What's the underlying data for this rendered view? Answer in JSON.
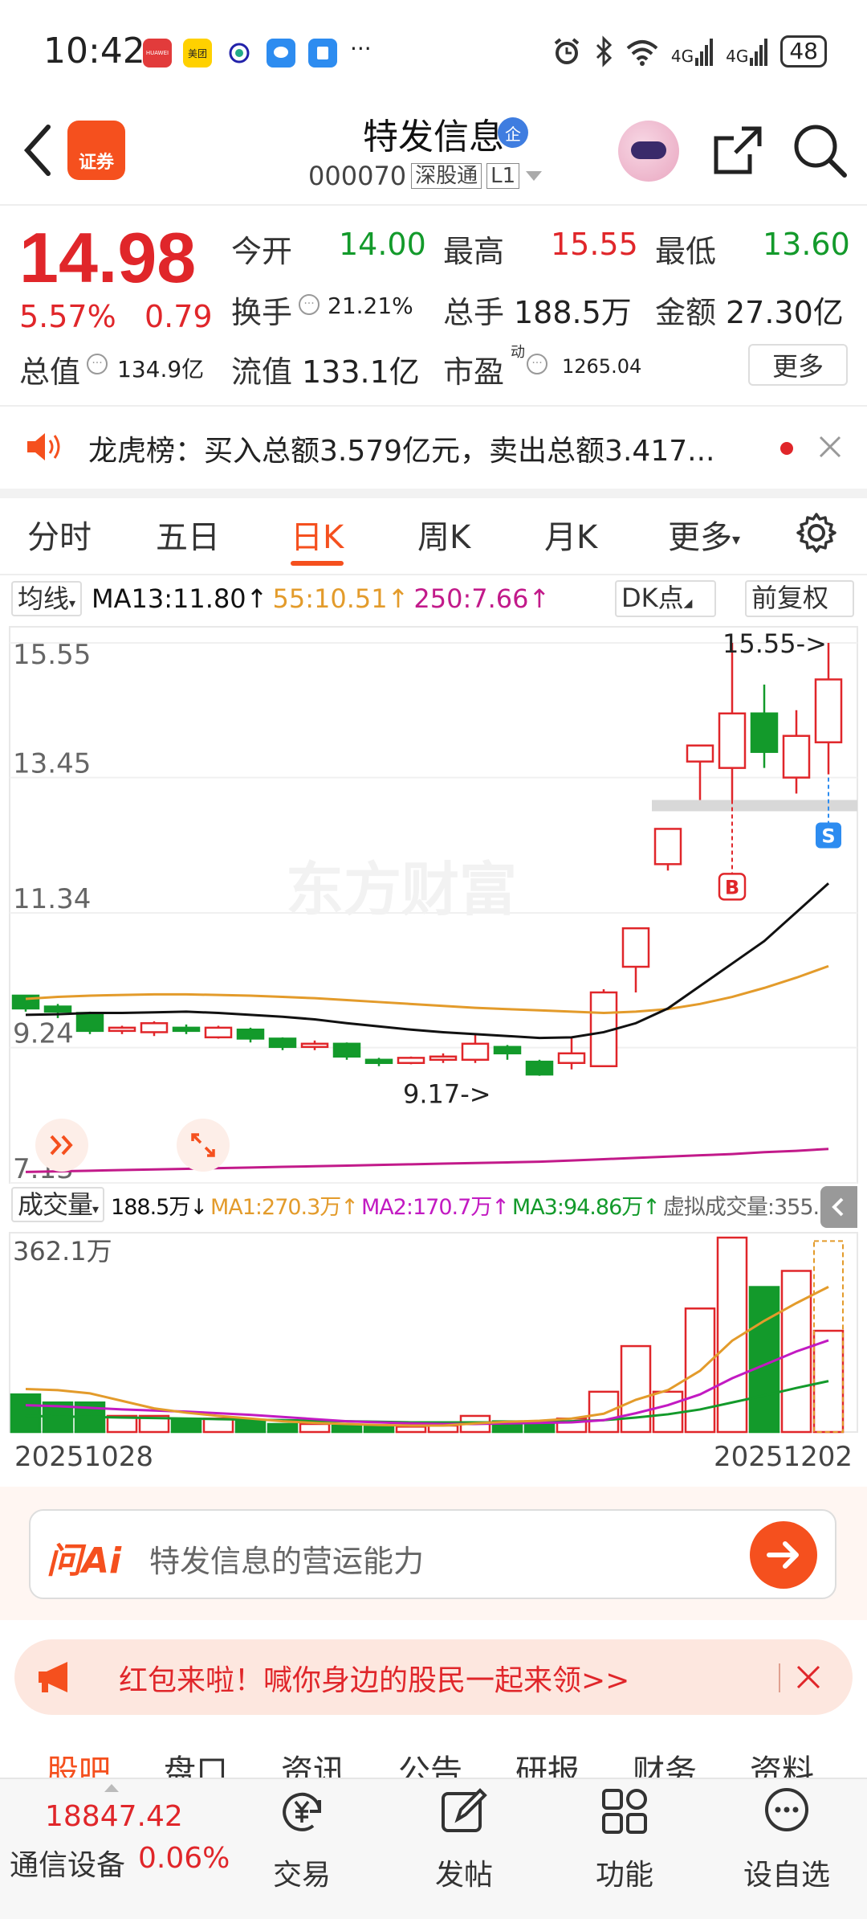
{
  "status_bar": {
    "time": "10:42",
    "battery": "48",
    "more": "···",
    "signal_label": "4G",
    "apps": [
      "HUAWEI",
      "美团",
      "",
      "",
      ""
    ]
  },
  "header": {
    "stock_name": "特发信息",
    "badge": "企",
    "stock_code": "000070",
    "tag_connect": "深股通",
    "tag_level": "L1",
    "app_logo_text": "证券"
  },
  "quote": {
    "price": "14.98",
    "change_pct": "5.57%",
    "change_amt": "0.79",
    "open_label": "今开",
    "open": "14.00",
    "high_label": "最高",
    "high": "15.55",
    "low_label": "最低",
    "low": "13.60",
    "turnover_label": "换手",
    "turnover": "21.21%",
    "volume_label": "总手",
    "volume": "188.5万",
    "amount_label": "金额",
    "amount": "27.30亿",
    "mcap_label": "总值",
    "mcap": "134.9亿",
    "float_label": "流值",
    "float_cap": "133.1亿",
    "pe_label": "市盈",
    "pe_sup": "动",
    "pe": "1265.04",
    "more_button": "更多"
  },
  "banner": {
    "text": "龙虎榜：买入总额3.579亿元，卖出总额3.417..."
  },
  "tabs": [
    {
      "label": "分时",
      "active": false
    },
    {
      "label": "五日",
      "active": false
    },
    {
      "label": "日K",
      "active": true
    },
    {
      "label": "周K",
      "active": false
    },
    {
      "label": "月K",
      "active": false
    },
    {
      "label": "更多",
      "active": false
    }
  ],
  "ma_legend": {
    "selector": "均线",
    "ma13": "MA13:11.80↑",
    "ma55": "55:10.51↑",
    "ma250": "250:7.66↑",
    "dk_button": "DK点",
    "adjust_button": "前复权"
  },
  "volume_legend": {
    "selector": "成交量",
    "vol": "188.5万↓",
    "ma1": "MA1:270.3万↑",
    "ma2": "MA2:170.7万↑",
    "ma3": "MA3:94.86万↑",
    "virtual": "虚拟成交量:355.6万"
  },
  "colors": {
    "up": "#e0262a",
    "down": "#139a2b",
    "accent": "#f5501e",
    "ma13": "#111111",
    "ma55": "#e39b2b",
    "ma250": "#c21a8a",
    "vol_ma2": "#c21ac2"
  },
  "chart_data": {
    "type": "candlestick",
    "y_ticks": [
      "15.55",
      "13.45",
      "11.34",
      "9.24",
      "7.13"
    ],
    "ylim": [
      7.13,
      15.55
    ],
    "volume_max_label": "362.1万",
    "volume_ylim": [
      0,
      362.1
    ],
    "x_start": "20251028",
    "x_end": "20251202",
    "high_marker": "15.55->",
    "low_marker": "9.17->",
    "buy_marker": "B",
    "sell_marker": "S",
    "watermark": "东方财富",
    "candles": [
      {
        "o": 10.05,
        "c": 9.85,
        "h": 10.05,
        "l": 9.8
      },
      {
        "o": 9.88,
        "c": 9.8,
        "h": 9.92,
        "l": 9.7
      },
      {
        "o": 9.78,
        "c": 9.5,
        "h": 9.8,
        "l": 9.45
      },
      {
        "o": 9.5,
        "c": 9.55,
        "h": 9.58,
        "l": 9.45
      },
      {
        "o": 9.48,
        "c": 9.62,
        "h": 9.65,
        "l": 9.42
      },
      {
        "o": 9.55,
        "c": 9.5,
        "h": 9.6,
        "l": 9.45
      },
      {
        "o": 9.4,
        "c": 9.55,
        "h": 9.58,
        "l": 9.38
      },
      {
        "o": 9.52,
        "c": 9.38,
        "h": 9.55,
        "l": 9.32
      },
      {
        "o": 9.38,
        "c": 9.25,
        "h": 9.4,
        "l": 9.2
      },
      {
        "o": 9.25,
        "c": 9.3,
        "h": 9.35,
        "l": 9.2
      },
      {
        "o": 9.3,
        "c": 9.1,
        "h": 9.32,
        "l": 9.05
      },
      {
        "o": 9.05,
        "c": 9.0,
        "h": 9.08,
        "l": 8.95
      },
      {
        "o": 9.0,
        "c": 9.08,
        "h": 9.1,
        "l": 8.98
      },
      {
        "o": 9.05,
        "c": 9.1,
        "h": 9.15,
        "l": 9.0
      },
      {
        "o": 9.05,
        "c": 9.3,
        "h": 9.45,
        "l": 9.0
      },
      {
        "o": 9.25,
        "c": 9.15,
        "h": 9.28,
        "l": 9.05
      },
      {
        "o": 9.02,
        "c": 8.82,
        "h": 9.05,
        "l": 8.8
      },
      {
        "o": 9.0,
        "c": 9.15,
        "h": 9.4,
        "l": 8.9
      },
      {
        "o": 8.95,
        "c": 10.1,
        "h": 10.15,
        "l": 8.95
      },
      {
        "o": 10.5,
        "c": 11.1,
        "h": 11.1,
        "l": 10.1
      },
      {
        "o": 12.1,
        "c": 12.65,
        "h": 12.65,
        "l": 12.0
      },
      {
        "o": 13.7,
        "c": 13.95,
        "h": 13.95,
        "l": 13.05
      },
      {
        "o": 13.6,
        "c": 14.45,
        "h": 15.55,
        "l": 13.1
      },
      {
        "o": 14.45,
        "c": 13.85,
        "h": 14.9,
        "l": 13.6
      },
      {
        "o": 13.45,
        "c": 14.1,
        "h": 14.5,
        "l": 13.2
      },
      {
        "o": 14.0,
        "c": 14.98,
        "h": 15.55,
        "l": 13.5
      }
    ],
    "volumes": [
      70,
      55,
      55,
      30,
      30,
      25,
      25,
      20,
      15,
      15,
      12,
      10,
      10,
      12,
      30,
      20,
      20,
      25,
      75,
      160,
      75,
      230,
      362,
      270,
      300,
      188.5
    ],
    "virtual_volume": 355.6,
    "ma13": [
      9.75,
      9.76,
      9.78,
      9.78,
      9.79,
      9.8,
      9.78,
      9.75,
      9.72,
      9.68,
      9.62,
      9.57,
      9.52,
      9.48,
      9.45,
      9.42,
      9.39,
      9.4,
      9.48,
      9.62,
      9.85,
      10.2,
      10.55,
      10.9,
      11.35,
      11.8
    ],
    "ma55": [
      10.0,
      10.03,
      10.05,
      10.06,
      10.07,
      10.07,
      10.06,
      10.05,
      10.03,
      10.01,
      9.98,
      9.95,
      9.92,
      9.89,
      9.86,
      9.84,
      9.82,
      9.8,
      9.78,
      9.8,
      9.84,
      9.92,
      10.03,
      10.17,
      10.33,
      10.51
    ],
    "ma250": [
      7.3,
      7.31,
      7.32,
      7.33,
      7.34,
      7.35,
      7.36,
      7.37,
      7.38,
      7.39,
      7.4,
      7.41,
      7.42,
      7.43,
      7.44,
      7.45,
      7.46,
      7.48,
      7.5,
      7.52,
      7.54,
      7.56,
      7.58,
      7.61,
      7.63,
      7.66
    ],
    "vol_ma1": [
      80,
      78,
      72,
      58,
      44,
      36,
      30,
      25,
      20,
      17,
      15,
      13,
      12,
      12,
      16,
      19,
      21,
      25,
      34,
      60,
      78,
      114,
      170,
      207,
      240,
      270.3
    ],
    "vol_ma2": [
      50,
      48,
      45,
      42,
      40,
      38,
      35,
      32,
      28,
      24,
      20,
      18,
      16,
      15,
      15,
      16,
      17,
      18,
      22,
      35,
      50,
      70,
      100,
      125,
      150,
      170.7
    ],
    "vol_ma3": [
      30,
      29,
      28,
      27,
      26,
      25,
      24,
      23,
      22,
      21,
      20,
      19,
      18,
      18,
      18,
      18,
      19,
      20,
      22,
      27,
      33,
      42,
      55,
      68,
      82,
      94.86
    ]
  },
  "ai_box": {
    "logo": "问Ai",
    "placeholder": "特发信息的营运能力"
  },
  "red_packet": {
    "text": "红包来啦！喊你身边的股民一起来领>>"
  },
  "bottom_tabs": [
    "股吧",
    "盘口",
    "资讯",
    "公告",
    "研报",
    "财务",
    "资料"
  ],
  "bottom_nav": {
    "index_value": "18847.42",
    "index_name": "通信设备",
    "index_pct": "0.06%",
    "items": [
      "交易",
      "发帖",
      "功能",
      "设自选"
    ]
  }
}
